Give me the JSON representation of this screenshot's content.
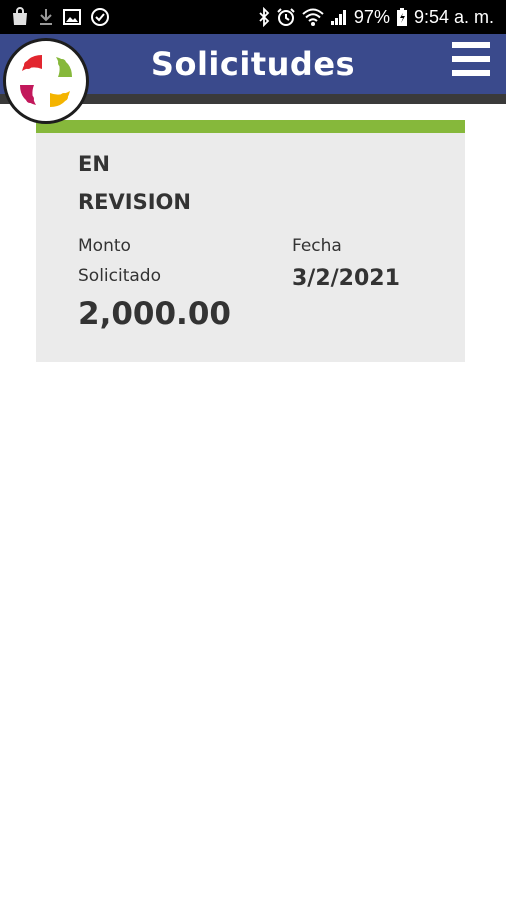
{
  "status_bar": {
    "left_icons": [
      "shopping-bag-icon",
      "download-icon",
      "image-icon",
      "check-circle-icon"
    ],
    "right_icons": [
      "bluetooth-icon",
      "alarm-icon",
      "wifi-icon",
      "signal-icon",
      "battery-charging-icon"
    ],
    "battery": "97%",
    "time": "9:54 a. m."
  },
  "app_bar": {
    "title": "Solicitudes",
    "menu_icon": "hamburger-menu-icon",
    "logo_icon": "app-logo-icon",
    "color": "#3a4a8c"
  },
  "request_card": {
    "accent_color": "#86b83b",
    "status_line_1": "EN",
    "status_line_2": "REVISION",
    "amount_label_line_1": "Monto",
    "amount_label_line_2": "Solicitado",
    "amount_value": "2,000.00",
    "date_label": "Fecha",
    "date_value": "3/2/2021"
  }
}
